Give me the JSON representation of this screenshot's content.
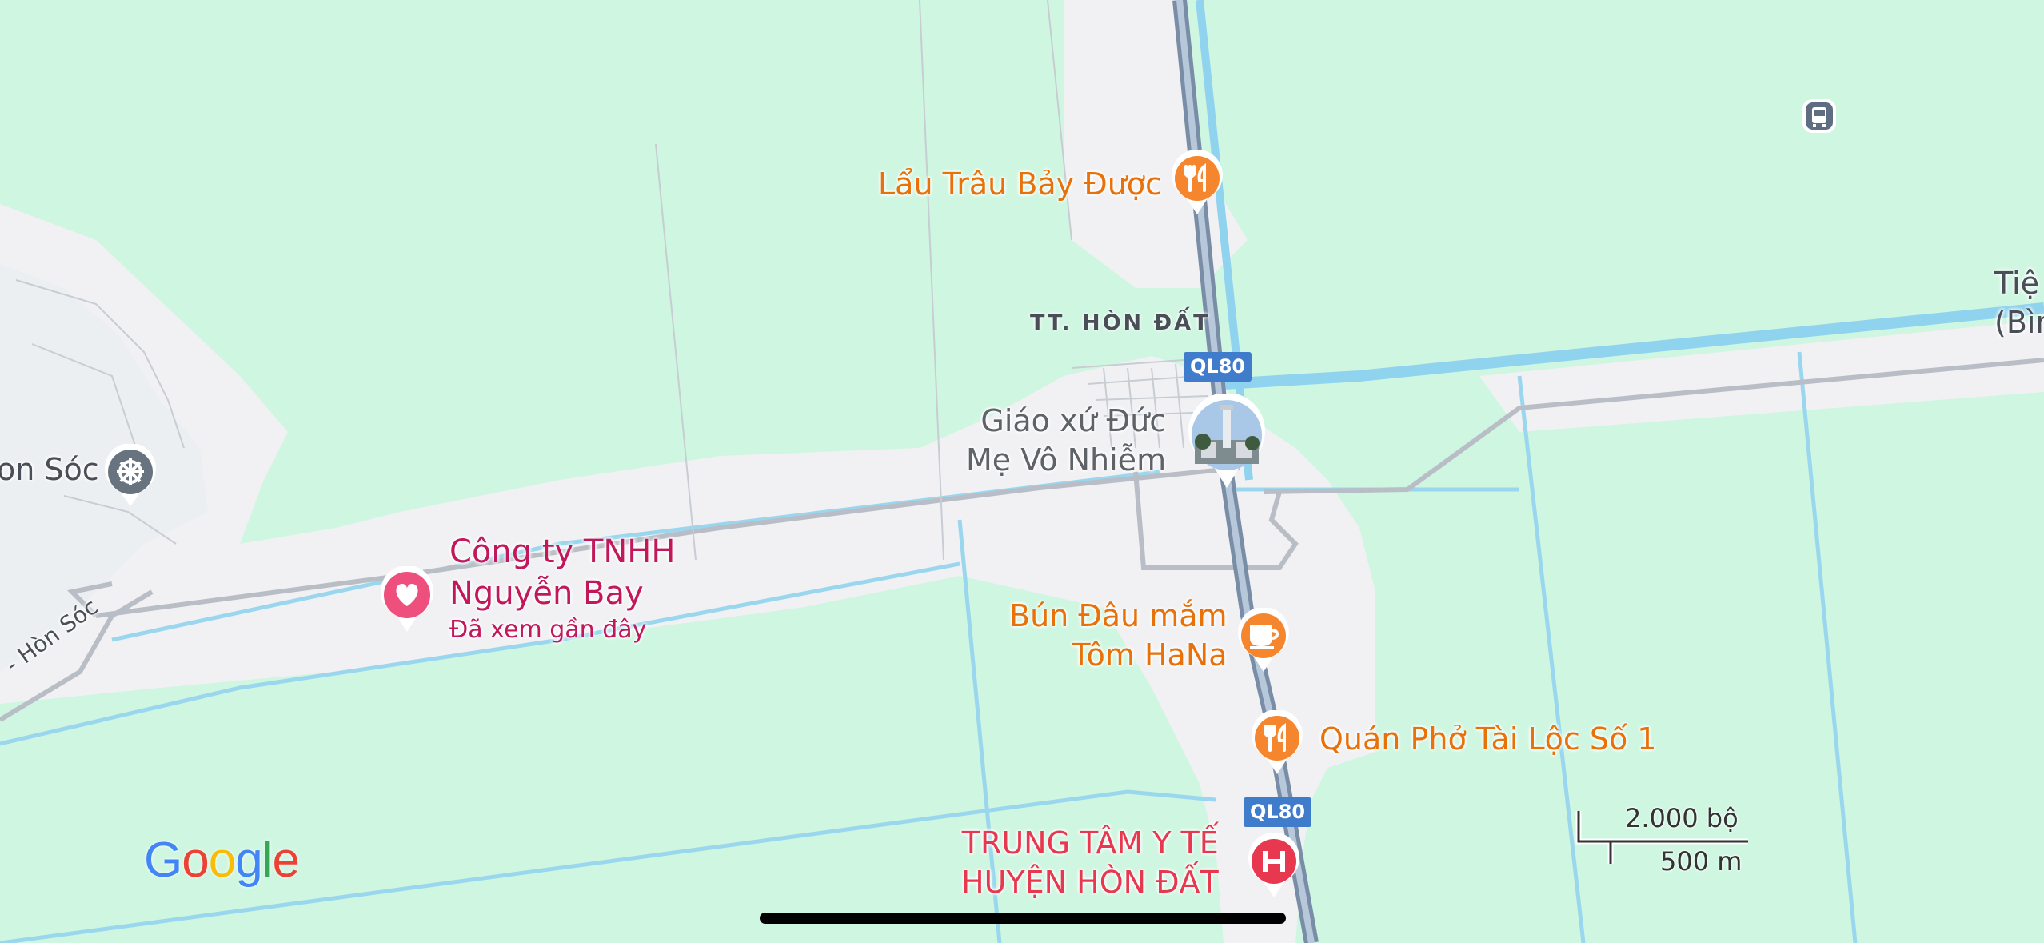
{
  "map": {
    "town_label": "TT. HÒN ĐẤT",
    "road_shields": [
      "QL80",
      "QL80"
    ],
    "road_labels": {
      "left_road": "- Hòn Sóc"
    },
    "edge_labels": {
      "left_place": "on Sóc",
      "right_place_line1": "Tiệ",
      "right_place_line2": "(Bìn"
    },
    "pois": [
      {
        "name": "Lẩu Trâu Bảy Được",
        "category": "restaurant",
        "icon": "fork-knife-icon",
        "color": "#e8710a"
      },
      {
        "name_line1": "Giáo xứ Đức",
        "name_line2": "Mẹ Vô Nhiễm",
        "category": "church",
        "icon": "photo-thumbnail",
        "color": "#5f6368"
      },
      {
        "name_line1": "Công ty TNHH",
        "name_line2": "Nguyễn Bay",
        "subtitle": "Đã xem gần đây",
        "category": "saved",
        "icon": "heart-icon",
        "color": "#c2185b"
      },
      {
        "name_line1": "Bún Đâu mắm",
        "name_line2": "Tôm HaNa",
        "category": "cafe",
        "icon": "coffee-cup-icon",
        "color": "#e8710a"
      },
      {
        "name": "Quán Phở Tài Lộc Số 1",
        "category": "restaurant",
        "icon": "fork-knife-icon",
        "color": "#e8710a"
      },
      {
        "name_line1": "TRUNG TÂM Y TẾ",
        "name_line2": "HUYỆN HÒN ĐẤT",
        "category": "hospital",
        "icon": "hospital-h-icon",
        "color": "#e8384f"
      }
    ],
    "scale": {
      "imperial": "2.000 bộ",
      "metric": "500 m"
    },
    "logo": "Google"
  }
}
